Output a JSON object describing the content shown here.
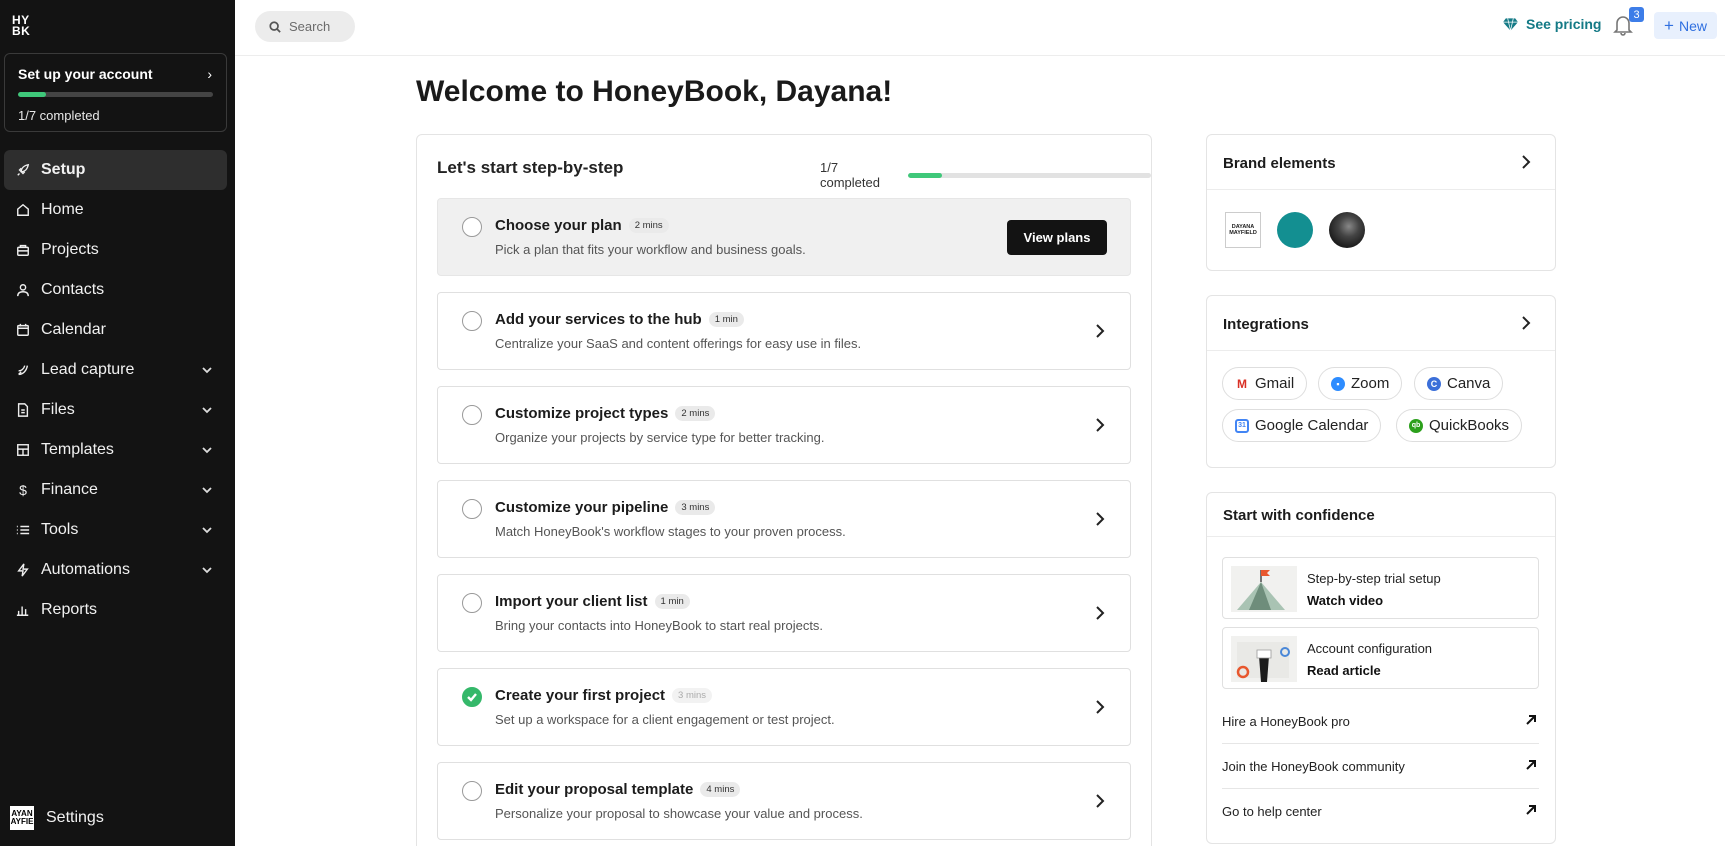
{
  "brand": {
    "logo_text": "HY\nBK"
  },
  "setup": {
    "title": "Set up your account",
    "progress": "1/7 completed",
    "fraction": 0.142
  },
  "nav": [
    {
      "label": "Setup",
      "icon": "rocket-icon",
      "active": true,
      "caret": false
    },
    {
      "label": "Home",
      "icon": "home-icon",
      "caret": false
    },
    {
      "label": "Projects",
      "icon": "briefcase-icon",
      "caret": false
    },
    {
      "label": "Contacts",
      "icon": "person-icon",
      "caret": false
    },
    {
      "label": "Calendar",
      "icon": "calendar-icon",
      "caret": false
    },
    {
      "label": "Lead capture",
      "icon": "magnet-icon",
      "caret": true
    },
    {
      "label": "Files",
      "icon": "file-icon",
      "caret": true
    },
    {
      "label": "Templates",
      "icon": "layout-icon",
      "caret": true
    },
    {
      "label": "Finance",
      "icon": "dollar-icon",
      "caret": true
    },
    {
      "label": "Tools",
      "icon": "list-icon",
      "caret": true
    },
    {
      "label": "Automations",
      "icon": "lightning-icon",
      "caret": true
    },
    {
      "label": "Reports",
      "icon": "bar-chart-icon",
      "caret": false
    }
  ],
  "settings": {
    "label": "Settings",
    "avatar_text": "AYAN\nAYFIE"
  },
  "header": {
    "search_placeholder": "Search",
    "pricing_label": "See pricing",
    "notification_count": "3",
    "new_label": "New"
  },
  "main": {
    "welcome": "Welcome to HoneyBook, Dayana!",
    "steps_title": "Let's start step-by-step",
    "steps_progress": "1/7 completed",
    "steps_fraction": 0.142,
    "view_plans_label": "View plans",
    "steps": [
      {
        "title": "Choose your plan",
        "time": "2 mins",
        "desc": "Pick a plan that fits your workflow and business goals.",
        "done": false
      },
      {
        "title": "Add your services to the hub",
        "time": "1 min",
        "desc": "Centralize your SaaS and content offerings for easy use in files.",
        "done": false
      },
      {
        "title": "Customize project types",
        "time": "2 mins",
        "desc": "Organize your projects by service type for better tracking.",
        "done": false
      },
      {
        "title": "Customize your pipeline",
        "time": "3 mins",
        "desc": "Match HoneyBook's workflow stages to your proven process.",
        "done": false
      },
      {
        "title": "Import your client list",
        "time": "1 min",
        "desc": "Bring your contacts into HoneyBook to start real projects.",
        "done": false
      },
      {
        "title": "Create your first project",
        "time": "3 mins",
        "desc": "Set up a workspace for a client engagement or test project.",
        "done": true
      },
      {
        "title": "Edit your proposal template",
        "time": "4 mins",
        "desc": "Personalize your proposal to showcase your value and process.",
        "done": false
      }
    ]
  },
  "brand_elements": {
    "title": "Brand elements",
    "logo_text": "DAYANA\nMAYFIELD",
    "brand_color": "#138f91"
  },
  "integrations": {
    "title": "Integrations",
    "items": [
      {
        "label": "Gmail",
        "icon": "gmail-icon",
        "color": "#d93025"
      },
      {
        "label": "Zoom",
        "icon": "zoom-icon",
        "color": "#2d8cff"
      },
      {
        "label": "Canva",
        "icon": "canva-icon",
        "color": "#00c4cc"
      },
      {
        "label": "Google Calendar",
        "icon": "google-calendar-icon",
        "color": "#4285f4"
      },
      {
        "label": "QuickBooks",
        "icon": "quickbooks-icon",
        "color": "#2ca01c"
      }
    ]
  },
  "confidence": {
    "title": "Start with confidence",
    "resources": [
      {
        "line1": "Step-by-step trial setup",
        "line2": "Watch video"
      },
      {
        "line1": "Account configuration",
        "line2": "Read article"
      }
    ],
    "links": [
      {
        "label": "Hire a HoneyBook pro"
      },
      {
        "label": "Join the HoneyBook community"
      },
      {
        "label": "Go to help center"
      }
    ]
  },
  "colors": {
    "accent_green": "#3fc87a",
    "teal": "#147a86",
    "new_blue": "#2f6fe0",
    "sidebar": "#131313"
  }
}
